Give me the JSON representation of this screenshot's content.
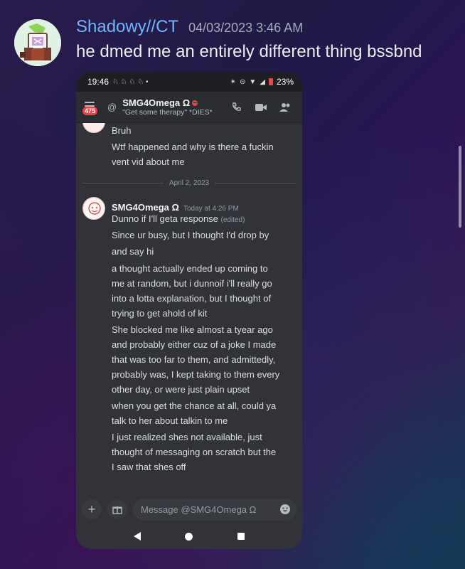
{
  "message": {
    "username": "Shadowy//CT",
    "timestamp": "04/03/2023 3:46 AM",
    "text": "he dmed me an entirely different thing bssbnd"
  },
  "phone": {
    "statusbar": {
      "time": "19:46",
      "battery": "23%"
    },
    "header": {
      "badge": "475",
      "channel_name": "SMG4Omega Ω",
      "custom_status": "\"Get some therapy\" *DIES*"
    },
    "chat": {
      "previous_lines": [
        "Bruh",
        "Wtf happened and why is there a fuckin",
        "vent vid about me"
      ],
      "date_divider": "April 2, 2023",
      "author": "SMG4Omega Ω",
      "author_time": "Today at 4:26 PM",
      "edited_tag": "(edited)",
      "lines": [
        "Dunno if I'll geta response",
        "Since ur busy, but I thought I'd drop by",
        "and say hi",
        "a thought actually ended up coming to",
        "me at random, but i dunnoif i'll really go",
        "into a lotta explanation, but I thought of",
        "trying to get ahold of kit",
        "She blocked me like almost a tyear ago",
        "and probably either cuz of a joke I made",
        "that was too far to them, and admittedly,",
        "probably was, I kept taking to them every",
        "other day, or were just plain upset",
        "when you get the chance at all, could ya",
        "talk to her about talkin to me",
        "I just realized shes not available, just",
        "thought of messaging on scratch but the",
        "I saw that shes off"
      ]
    },
    "composer": {
      "placeholder": "Message @SMG4Omega Ω"
    }
  },
  "colors": {
    "username": "#6fb6ff",
    "discord_bg": "#313338",
    "badge_red": "#f23f43"
  }
}
